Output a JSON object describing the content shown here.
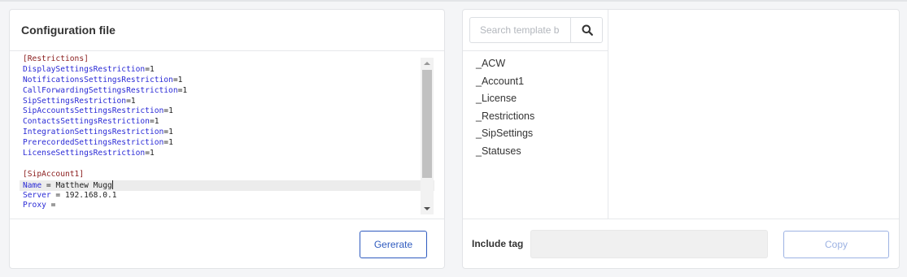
{
  "config_panel": {
    "title": "Configuration file",
    "generate_label": "Gererate",
    "editor_lines": [
      {
        "section": "Restrictions"
      },
      {
        "key": "DisplaySettingsRestriction",
        "value": "1"
      },
      {
        "key": "NotificationsSettingsRestriction",
        "value": "1"
      },
      {
        "key": "CallForwardingSettingsRestriction",
        "value": "1"
      },
      {
        "key": "SipSettingsRestriction",
        "value": "1"
      },
      {
        "key": "SipAccountsSettingsRestriction",
        "value": "1"
      },
      {
        "key": "ContactsSettingsRestriction",
        "value": "1"
      },
      {
        "key": "IntegrationSettingsRestriction",
        "value": "1"
      },
      {
        "key": "PrerecordedSettingsRestriction",
        "value": "1"
      },
      {
        "key": "LicenseSettingsRestriction",
        "value": "1"
      },
      {
        "blank": true
      },
      {
        "section": "SipAccount1"
      },
      {
        "key": "Name",
        "value": "Matthew Mugg",
        "spaced": true,
        "active": true
      },
      {
        "key": "Server",
        "value": "192.168.0.1",
        "spaced": true
      },
      {
        "key": "Proxy",
        "value": "",
        "spaced": true
      }
    ]
  },
  "template_panel": {
    "search": {
      "placeholder": "Search template b"
    },
    "templates": [
      "_ACW",
      "_Account1",
      "_License",
      "_Restrictions",
      "_SipSettings",
      "_Statuses"
    ],
    "include_tag_label": "Include tag",
    "include_tag_value": "",
    "copy_label": "Copy"
  },
  "colors": {
    "accent": "#2f5bbf",
    "accent_disabled": "#9db3e3",
    "code_key": "#2b2bd6",
    "code_section": "#8a1c1c"
  },
  "icons": {
    "search_button": "search-icon"
  }
}
